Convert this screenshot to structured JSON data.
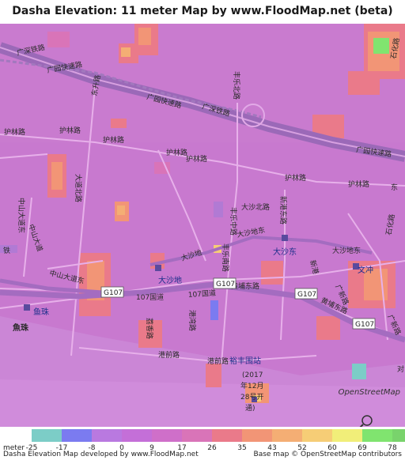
{
  "title": "Dasha Elevation: 11 meter Map by www.FloodMap.net (beta)",
  "map": {
    "labels": {
      "guangyuan_expressway_1": "广园快速路",
      "guangyuan_expressway_2": "广园快速路",
      "guangyuan_expressway_3": "广园快速路",
      "guangshen_railway_1": "广深铁路",
      "guangshen_railway_2": "广深铁路",
      "hulin_road_1": "护林路",
      "hulin_road_2": "护林路",
      "hulin_road_3": "护林路",
      "hulin_road_4": "护林路",
      "hulin_road_5": "护林路",
      "hulin_road_6": "护林路",
      "hulin_road_7": "护林路",
      "dasha_north_road": "大沙北路",
      "dasha_east_1": "大沙东",
      "dasha_east_2": "大沙东",
      "dasha_east_road": "大沙地东",
      "dasha_east_road_2": "大沙地东",
      "dasha_di": "大沙地",
      "dasha_road": "大沙地",
      "fengle_north_road": "丰乐北路",
      "fengle_middle_road": "丰乐中路",
      "fengle_south_road": "丰乐南路",
      "xinyuan_road": "新港东路",
      "zhongshan_avenue": "中山大道东",
      "zhongshan_avenue_2": "中山大道东",
      "zhongshan_road": "中山大道",
      "huangpu_east_road": "黄埔东路",
      "huangpu_east_road_2": "黄埔东路",
      "road_107_1": "107国道",
      "road_107_2": "107国道",
      "g107_1": "G107",
      "g107_2": "G107",
      "g107_3": "G107",
      "g107_4": "G107",
      "yuzhu": "鱼珠",
      "yuzhu_2": "魚珠",
      "wenchong": "文冲",
      "gangqian_road": "港前路",
      "gangqian_road_2": "港前路",
      "yufeng_wei": "裕丰围站",
      "open_note_1": "(2017",
      "open_note_2": "年12月",
      "open_note_3": "28号开",
      "open_note_4": "通)",
      "shihua_road": "石化路",
      "shihua_road_2": "石化路",
      "guangxin_road": "广新路",
      "guangxin_road_2": "广新路",
      "dadaobei_road": "大道北路",
      "dongsheng_road": "东升路",
      "lingshan_road": "荔香路",
      "jiangbian_road": "港湾路",
      "xinggang_road": "新港",
      "jie_label": "铁",
      "dong_label": "东",
      "dui_label": "对",
      "zhongshan_east": "中山大道东"
    }
  },
  "attribution": "OpenStreetMap",
  "legend": {
    "unit": "meter",
    "ticks": [
      "-25",
      "-17",
      "-8",
      "0",
      "9",
      "17",
      "26",
      "35",
      "43",
      "52",
      "60",
      "69",
      "78"
    ],
    "colors": [
      "#7ccdc7",
      "#7b7bf0",
      "#b979e0",
      "#c46fd8",
      "#cf6fc9",
      "#d974b8",
      "#ea7a8a",
      "#f29576",
      "#f4ae74",
      "#f6cd76",
      "#f1ee79",
      "#80e46f",
      "#79d36c"
    ]
  },
  "footer": {
    "left": "Dasha Elevation Map developed by www.FloodMap.net",
    "right": "Base map © OpenStreetMap contributors"
  }
}
